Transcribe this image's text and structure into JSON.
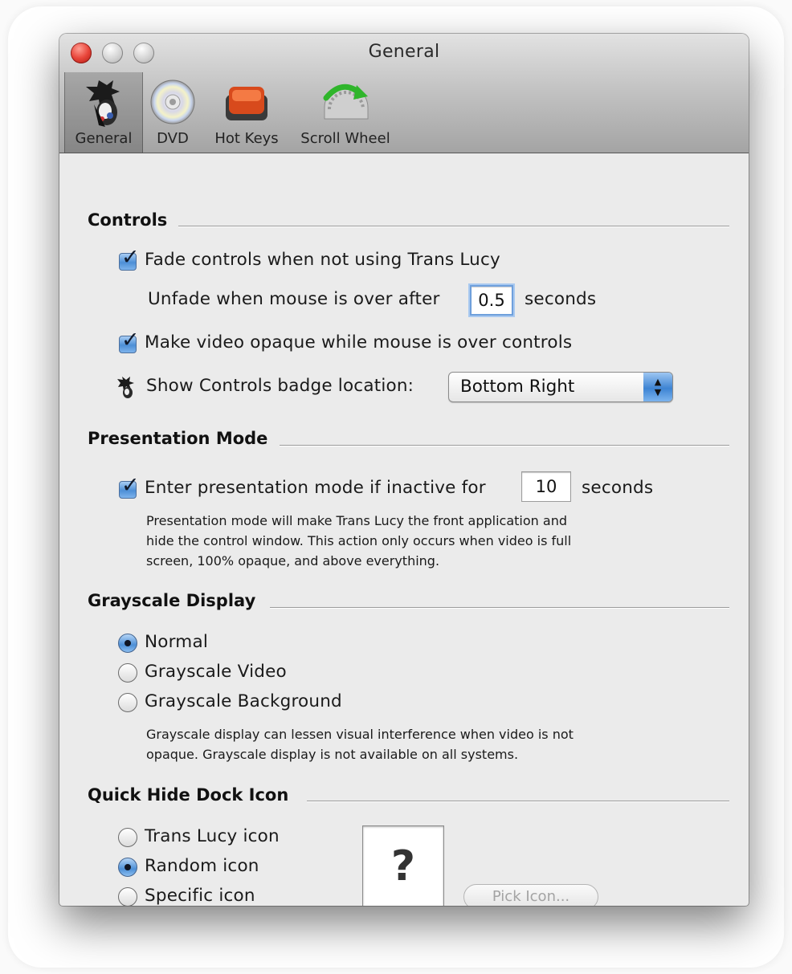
{
  "window": {
    "title": "General"
  },
  "toolbar": {
    "items": [
      {
        "label": "General",
        "icon": "trans-lucy-icon",
        "selected": true
      },
      {
        "label": "DVD",
        "icon": "dvd-disc-icon",
        "selected": false
      },
      {
        "label": "Hot Keys",
        "icon": "hot-key-icon",
        "selected": false
      },
      {
        "label": "Scroll Wheel",
        "icon": "scroll-wheel-icon",
        "selected": false
      }
    ]
  },
  "controls": {
    "header": "Controls",
    "fade_label": "Fade controls when not using Trans Lucy",
    "fade_checked": true,
    "unfade_label": "Unfade when mouse is over after",
    "unfade_value": "0.5",
    "unfade_suffix": "seconds",
    "opaque_label": "Make video opaque while mouse is over controls",
    "opaque_checked": true,
    "badge_label": "Show Controls badge location:",
    "badge_value": "Bottom Right"
  },
  "presentation": {
    "header": "Presentation Mode",
    "enter_label": "Enter presentation mode if inactive for",
    "enter_checked": true,
    "enter_value": "10",
    "enter_suffix": "seconds",
    "note_line1": "Presentation mode will make Trans Lucy the front application and",
    "note_line2": "hide the control window.  This action only occurs when video is full",
    "note_line3": "screen, 100% opaque, and above everything."
  },
  "grayscale": {
    "header": "Grayscale Display",
    "options": [
      "Normal",
      "Grayscale Video",
      "Grayscale Background"
    ],
    "selected": "Normal",
    "note_line1": "Grayscale display can lessen visual interference when video is not",
    "note_line2": "opaque.  Grayscale display is not available on all systems."
  },
  "quickhide": {
    "header": "Quick Hide Dock Icon",
    "options": [
      "Trans Lucy icon",
      "Random icon",
      "Specific icon"
    ],
    "selected": "Random icon",
    "preview_symbol": "?",
    "pick_button": "Pick Icon..."
  },
  "colors": {
    "checkbox_blue": "#4d8fd6",
    "close_red": "#e8453a",
    "window_bg": "#ebebeb"
  }
}
